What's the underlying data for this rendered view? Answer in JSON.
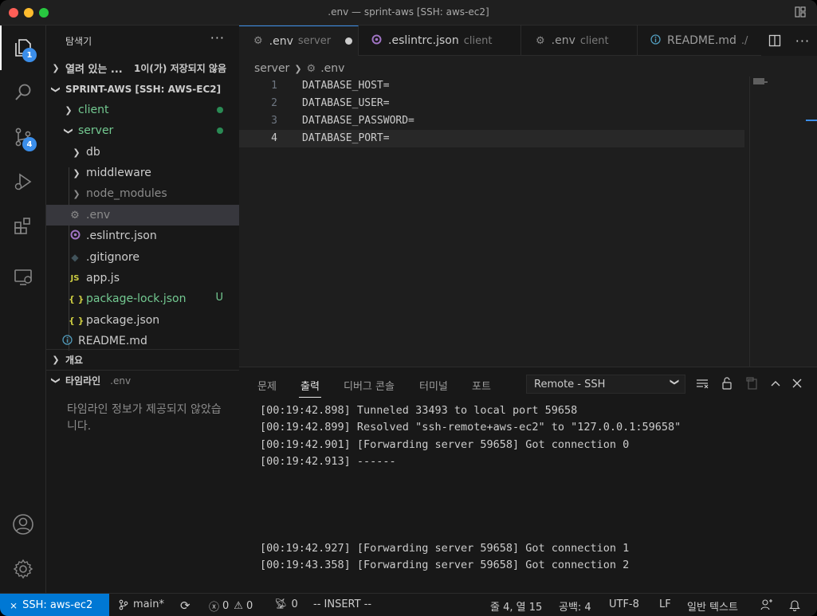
{
  "window": {
    "title": ".env — sprint-aws [SSH: aws-ec2]"
  },
  "activity_bar": {
    "explorer_badge": "1",
    "scm_badge": "4"
  },
  "sidebar": {
    "title": "탐색기",
    "more": "···",
    "open_editors": {
      "label": "열려 있는 ...",
      "status": "1이(가) 저장되지 않음"
    },
    "workspace": "SPRINT-AWS [SSH: AWS-EC2]",
    "tree": [
      {
        "label": "client",
        "type": "folder",
        "color": "#73c991"
      },
      {
        "label": "server",
        "type": "folder",
        "color": "#73c991"
      },
      {
        "label": "db",
        "type": "folder"
      },
      {
        "label": "middleware",
        "type": "folder"
      },
      {
        "label": "node_modules",
        "type": "folder"
      },
      {
        "label": ".env",
        "type": "file",
        "icon": "gear-icon"
      },
      {
        "label": ".eslintrc.json",
        "type": "file",
        "icon": "eslint-icon"
      },
      {
        "label": ".gitignore",
        "type": "file",
        "icon": "git-icon"
      },
      {
        "label": "app.js",
        "type": "file",
        "icon": "js-icon",
        "icon_text": "JS"
      },
      {
        "label": "package-lock.json",
        "type": "file",
        "icon": "json-icon",
        "icon_text": "{ }",
        "git_status": "U"
      },
      {
        "label": "package.json",
        "type": "file",
        "icon": "json-icon",
        "icon_text": "{ }"
      },
      {
        "label": "README.md",
        "type": "file",
        "icon": "info-icon"
      }
    ],
    "outline_label": "개요",
    "timeline_label": "타임라인",
    "timeline_file": ".env",
    "timeline_message": "타임라인 정보가 제공되지 않았습니다."
  },
  "tabs": [
    {
      "label": ".env",
      "sub": "server",
      "dirty": true,
      "active": true
    },
    {
      "label": ".eslintrc.json",
      "sub": "client"
    },
    {
      "label": ".env",
      "sub": "client"
    },
    {
      "label": "README.md",
      "sub": "./"
    }
  ],
  "breadcrumb": {
    "folder": "server",
    "file": ".env"
  },
  "editor": {
    "lines": [
      {
        "num": "1",
        "text": "DATABASE_HOST="
      },
      {
        "num": "2",
        "text": "DATABASE_USER="
      },
      {
        "num": "3",
        "text": "DATABASE_PASSWORD="
      },
      {
        "num": "4",
        "text": "DATABASE_PORT="
      }
    ]
  },
  "panel": {
    "tabs": [
      "문제",
      "출력",
      "디버그 콘솔",
      "터미널",
      "포트"
    ],
    "active_tab": "출력",
    "output_channel": "Remote - SSH",
    "output_lines": [
      "[00:19:42.898] Tunneled 33493 to local port 59658",
      "[00:19:42.899] Resolved \"ssh-remote+aws-ec2\" to \"127.0.0.1:59658\"",
      "[00:19:42.901] [Forwarding server 59658] Got connection 0",
      "[00:19:42.913] ------",
      "[00:19:42.927] [Forwarding server 59658] Got connection 1",
      "[00:19:43.358] [Forwarding server 59658] Got connection 2"
    ]
  },
  "status_bar": {
    "remote": "SSH: aws-ec2",
    "branch": "main*",
    "errors": "0",
    "warnings": "0",
    "ports": "0",
    "mode": "-- INSERT --",
    "position": "줄 4, 열 15",
    "spaces": "공백: 4",
    "encoding": "UTF-8",
    "eol": "LF",
    "language": "일반 텍스트"
  }
}
